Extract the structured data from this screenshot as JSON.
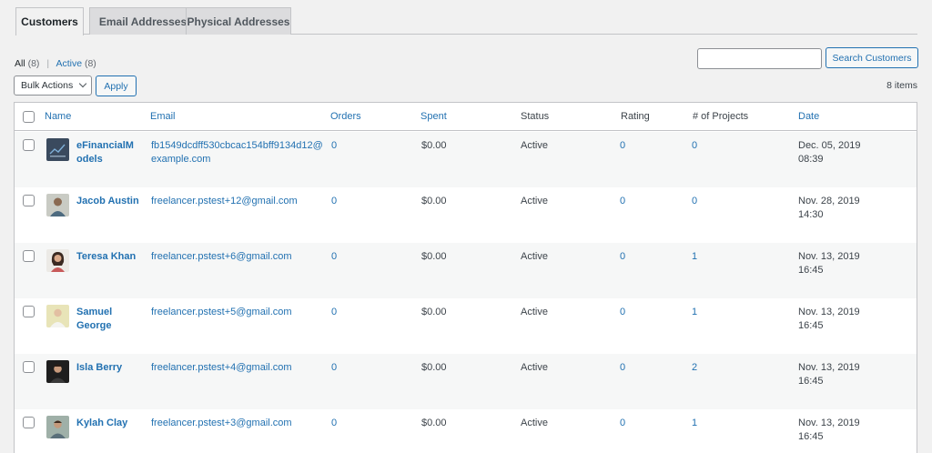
{
  "tabs": [
    {
      "label": "Customers"
    },
    {
      "label": "Email Addresses"
    },
    {
      "label": "Physical Addresses"
    }
  ],
  "views": {
    "all_label": "All",
    "all_count": "(8)",
    "separator": "|",
    "active_label": "Active",
    "active_count": "(8)"
  },
  "search": {
    "placeholder": "",
    "button_label": "Search Customers"
  },
  "bulk": {
    "selected": "Bulk Actions",
    "apply_label": "Apply"
  },
  "items_count": "8 items",
  "columns": {
    "name": "Name",
    "email": "Email",
    "orders": "Orders",
    "spent": "Spent",
    "status": "Status",
    "rating": "Rating",
    "projects": "# of Projects",
    "date": "Date"
  },
  "rows": [
    {
      "avatar": "efinancial-logo-avatar",
      "name": "eFinancialM odels",
      "email": "fb1549dcdff530cbcac154bff9134d12@ example.com",
      "orders": "0",
      "spent": "$0.00",
      "status": "Active",
      "rating": "0",
      "projects": "0",
      "date": "Dec. 05, 2019",
      "time": "08:39"
    },
    {
      "avatar": "user-photo-avatar",
      "name": "Jacob Austin",
      "email": "freelancer.pstest+12@gmail.com",
      "orders": "0",
      "spent": "$0.00",
      "status": "Active",
      "rating": "0",
      "projects": "0",
      "date": "Nov. 28, 2019",
      "time": "14:30"
    },
    {
      "avatar": "user-photo-avatar",
      "name": "Teresa Khan",
      "email": "freelancer.pstest+6@gmail.com",
      "orders": "0",
      "spent": "$0.00",
      "status": "Active",
      "rating": "0",
      "projects": "1",
      "date": "Nov. 13, 2019",
      "time": "16:45"
    },
    {
      "avatar": "user-photo-avatar",
      "name": "Samuel George",
      "email": "freelancer.pstest+5@gmail.com",
      "orders": "0",
      "spent": "$0.00",
      "status": "Active",
      "rating": "0",
      "projects": "1",
      "date": "Nov. 13, 2019",
      "time": "16:45"
    },
    {
      "avatar": "user-photo-avatar",
      "name": "Isla Berry",
      "email": "freelancer.pstest+4@gmail.com",
      "orders": "0",
      "spent": "$0.00",
      "status": "Active",
      "rating": "0",
      "projects": "2",
      "date": "Nov. 13, 2019",
      "time": "16:45"
    },
    {
      "avatar": "user-photo-avatar",
      "name": "Kylah Clay",
      "email": "freelancer.pstest+3@gmail.com",
      "orders": "0",
      "spent": "$0.00",
      "status": "Active",
      "rating": "0",
      "projects": "1",
      "date": "Nov. 13, 2019",
      "time": "16:45"
    }
  ],
  "colors": {
    "link": "#2271b1",
    "background": "#f1f1f1",
    "row_alt": "#f6f7f7"
  }
}
